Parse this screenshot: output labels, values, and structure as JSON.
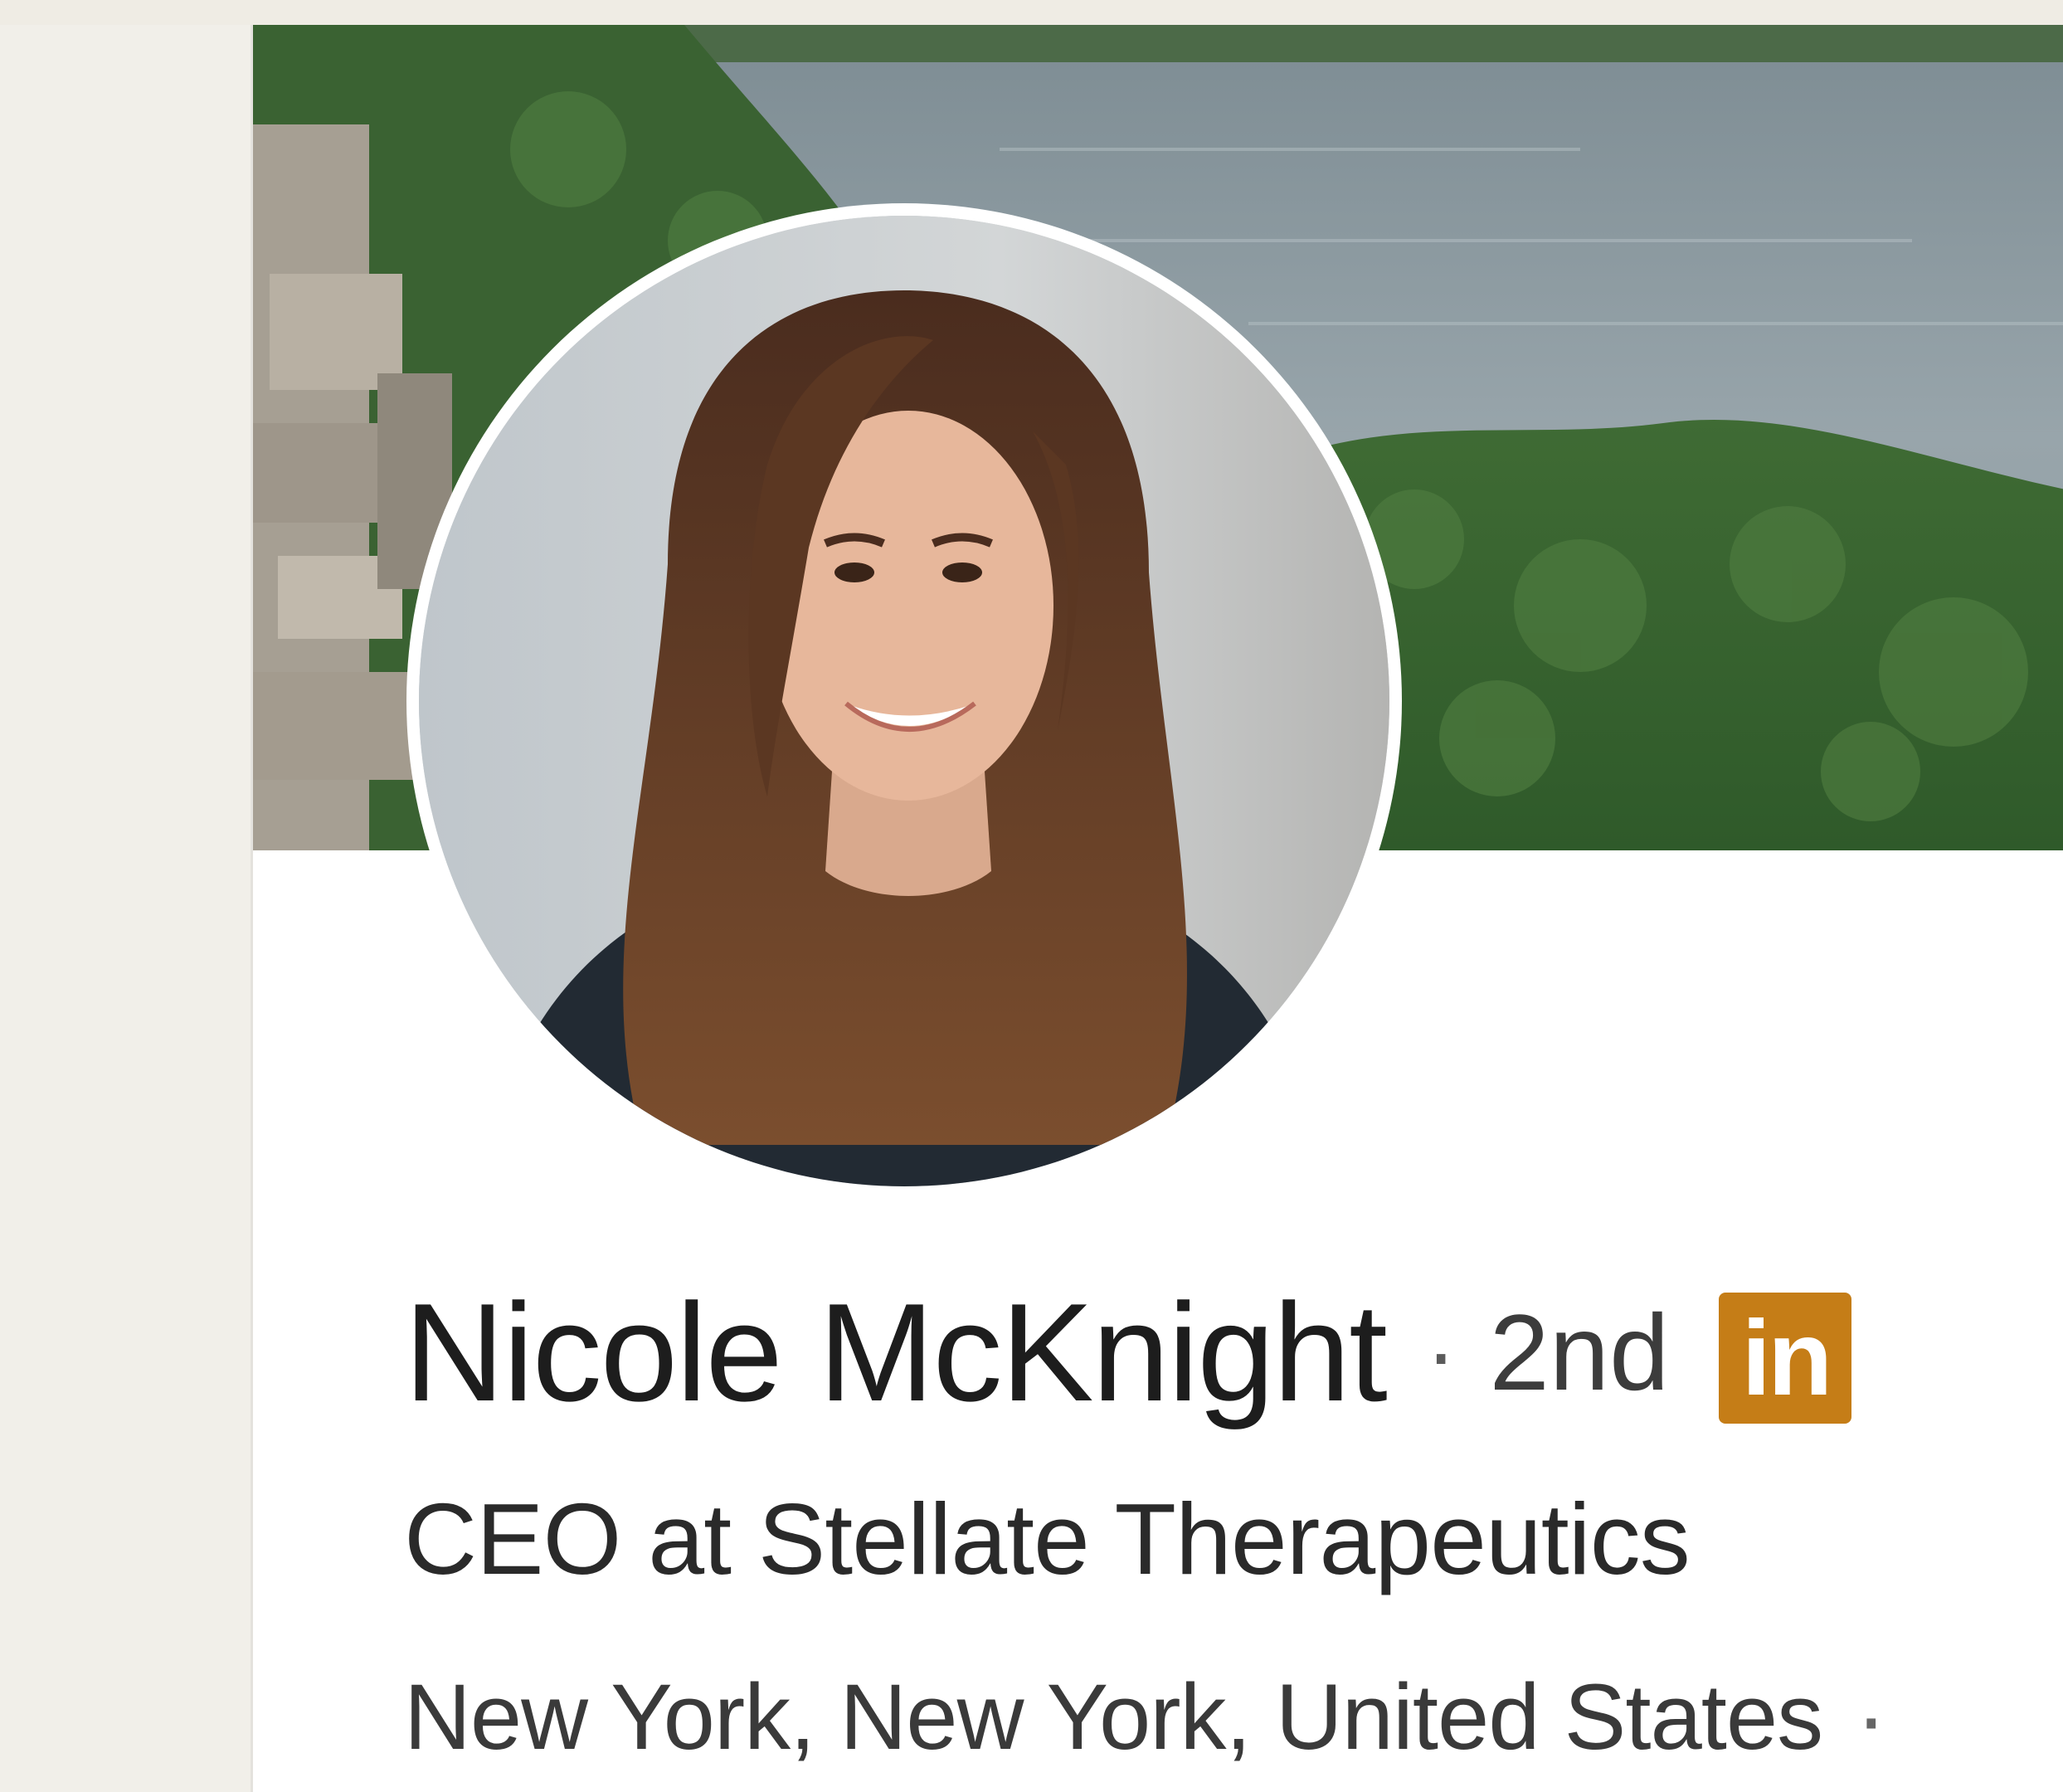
{
  "profile": {
    "name": "Nicole McKnight",
    "separator": "·",
    "connection_degree": "2nd",
    "network_badge": "in",
    "headline": "CEO at Stellate Therapeutics",
    "location": "New York, New York, United States",
    "location_separator": "·"
  },
  "icons": {
    "network_badge_icon": "linkedin-icon"
  },
  "colors": {
    "badge": "#c57d17",
    "card_background": "#ffffff",
    "page_background": "#f1efe9",
    "name_text": "#1d1d1d"
  }
}
